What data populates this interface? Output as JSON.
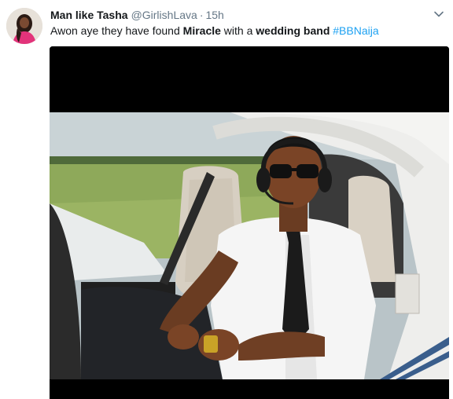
{
  "tweet": {
    "display_name": "Man like Tasha",
    "handle": "@GirlishLava",
    "separator": "·",
    "timestamp": "15h",
    "text_before_miracle": "Awon aye they have found ",
    "bold_miracle": "Miracle",
    "text_middle": " with a ",
    "bold_wedding_band": "wedding band",
    "text_after": " ",
    "hashtag": "#BBNaija"
  },
  "icons": {
    "menu": "chevron-down-icon",
    "avatar": "avatar"
  },
  "colors": {
    "name": "#14171a",
    "meta": "#657786",
    "hashtag": "#1da1f2"
  }
}
